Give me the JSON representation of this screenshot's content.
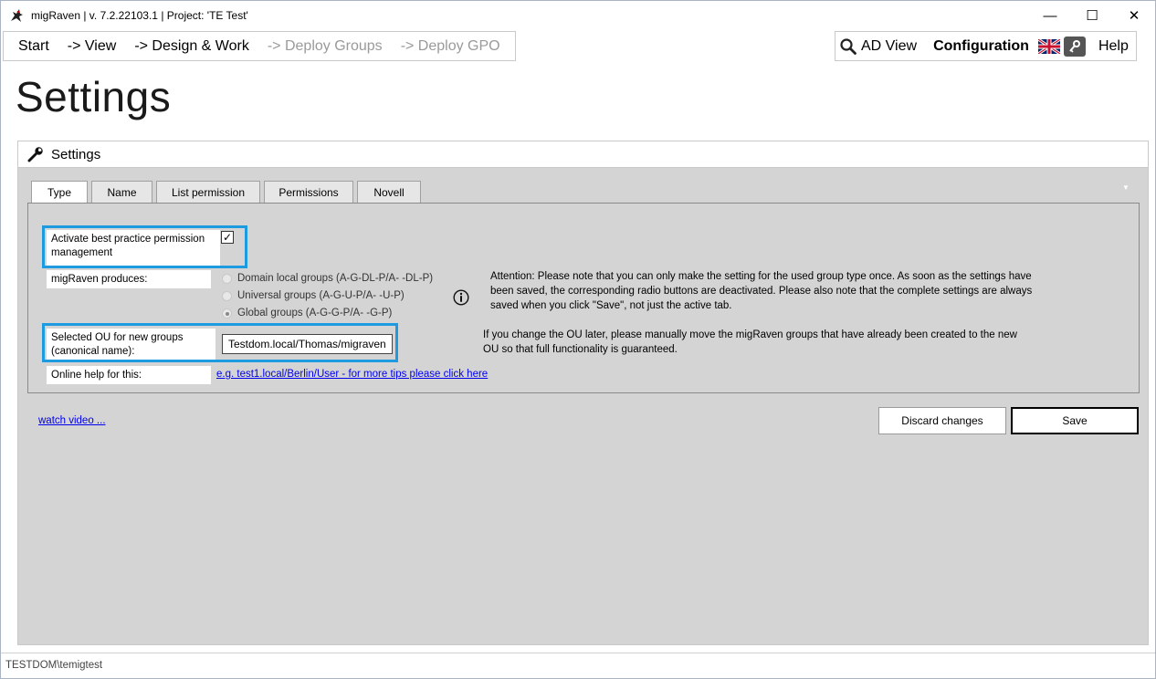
{
  "window": {
    "title": "migRaven | v. 7.2.22103.1 | Project: 'TE Test'",
    "controls": {
      "minimize": "—",
      "maximize": "☐",
      "close": "✕"
    }
  },
  "nav": {
    "left_items": [
      {
        "label": "Start",
        "enabled": true
      },
      {
        "label": "-> View",
        "enabled": true
      },
      {
        "label": "-> Design & Work",
        "enabled": true
      },
      {
        "label": "-> Deploy Groups",
        "enabled": false
      },
      {
        "label": "-> Deploy GPO",
        "enabled": false
      }
    ],
    "ad_view": "AD View",
    "configuration": "Configuration",
    "help": "Help"
  },
  "page_title": "Settings",
  "panel": {
    "title": "Settings",
    "tabs": [
      "Type",
      "Name",
      "List permission",
      "Permissions",
      "Novell"
    ],
    "active_tab": "Type",
    "best_practice_label": "Activate best practice permission management",
    "best_practice_checked": true,
    "produces_label": "migRaven produces:",
    "radio_options": [
      {
        "label": "Domain local groups (A-G-DL-P/A- -DL-P)",
        "selected": false
      },
      {
        "label": "Universal groups (A-G-U-P/A- -U-P)",
        "selected": false
      },
      {
        "label": "Global groups (A-G-G-P/A- -G-P)",
        "selected": true
      }
    ],
    "attention_text": "Attention: Please note that you can only make the setting for the used group type once. As soon as the settings have been saved, the corresponding radio buttons are deactivated. Please also note that the complete settings are always saved when you click \"Save\", not just the active tab.",
    "ou_label": "Selected OU for new groups (canonical name):",
    "ou_value": "Testdom.local/Thomas/migraven",
    "ou_note": "If you change the OU later, please manually move the migRaven groups that have already been created to the new OU so that full functionality is guaranteed.",
    "online_help_label": "Online help for this:",
    "online_help_link": "e.g. test1.local/Berlin/User - for more tips please click here",
    "watch_video": "watch video ...",
    "discard_label": "Discard changes",
    "save_label": "Save"
  },
  "status": {
    "user": "TESTDOM\\temigtest"
  },
  "colors": {
    "highlight": "#1e9be0",
    "panel_bg": "#d4d4d4",
    "link": "#0000ee"
  }
}
